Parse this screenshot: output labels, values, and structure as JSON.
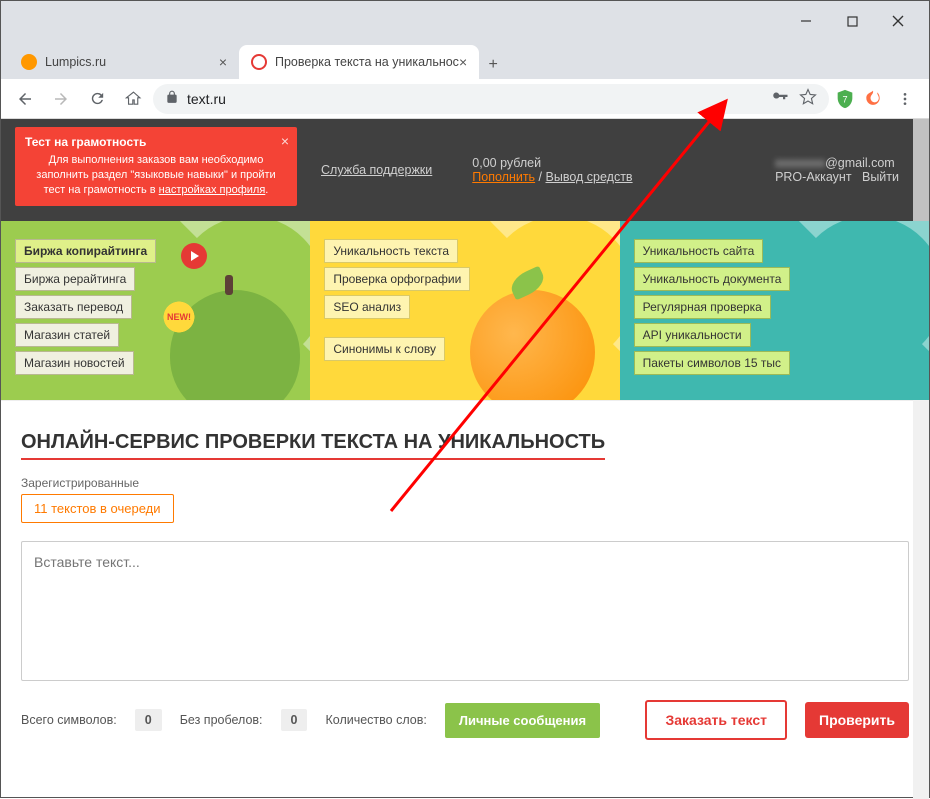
{
  "browser": {
    "tabs": [
      {
        "title": "Lumpics.ru",
        "favicon": "#ff9800"
      },
      {
        "title": "Проверка текста на уникальнос",
        "favicon": "#e53935"
      }
    ],
    "url": "text.ru",
    "ext_badge": "7"
  },
  "banner": {
    "title": "Тест на грамотность",
    "body_1": "Для выполнения заказов вам необходимо заполнить раздел \"языковые навыки\" и пройти тест на грамотность в ",
    "link": "настройках профиля",
    "close": "×"
  },
  "header": {
    "support": "Служба поддержки",
    "balance": "0,00 рублей",
    "topup": "Пополнить",
    "sep": " / ",
    "withdraw": "Вывод средств",
    "email_hidden": "xxxxxxxx",
    "email_domain": "@gmail.com",
    "pro": "PRO-Аккаунт",
    "logout": "Выйти"
  },
  "promo": {
    "col1": [
      "Биржа копирайтинга",
      "Биржа рерайтинга",
      "Заказать перевод",
      "Магазин статей",
      "Магазин новостей"
    ],
    "new": "NEW!",
    "col2": [
      "Уникальность текста",
      "Проверка орфографии",
      "SEO анализ",
      "Синонимы к слову"
    ],
    "col3": [
      "Уникальность сайта",
      "Уникальность документа",
      "Регулярная проверка",
      "API уникальности",
      "Пакеты символов 15 тыс"
    ]
  },
  "main": {
    "h1": "ОНЛАЙН-СЕРВИС ПРОВЕРКИ ТЕКСТА НА УНИКАЛЬНОСТЬ",
    "reg_label": "Зарегистрированные",
    "queue": "11 текстов в очереди",
    "placeholder": "Вставьте текст...",
    "stat1_label": "Всего символов:",
    "stat1_val": "0",
    "stat2_label": "Без пробелов:",
    "stat2_val": "0",
    "stat3_label": "Количество слов:",
    "pm": "Личные сообщения",
    "order": "Заказать текст",
    "check": "Проверить"
  }
}
